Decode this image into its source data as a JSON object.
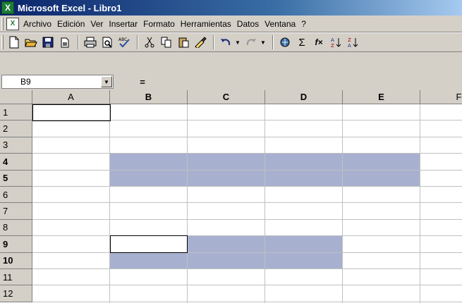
{
  "titlebar": {
    "icon": "X",
    "title": "Microsoft Excel - Libro1"
  },
  "menubar": {
    "items": [
      "Archivo",
      "Edición",
      "Ver",
      "Insertar",
      "Formato",
      "Herramientas",
      "Datos",
      "Ventana",
      "?"
    ]
  },
  "toolbar": {
    "buttons": [
      "new-icon",
      "open-icon",
      "save-icon",
      "permission-icon",
      "print-icon",
      "print-preview-icon",
      "spelling-icon",
      "cut-icon",
      "copy-icon",
      "paste-icon",
      "format-painter-icon",
      "undo-icon",
      "redo-icon",
      "hyperlink-icon",
      "autosum-icon",
      "function-icon",
      "sort-ascending-icon",
      "sort-descending-icon"
    ],
    "autosum_glyph": "Σ",
    "function_glyph": "f×"
  },
  "formulabar": {
    "name_box": "B9",
    "equals": "=",
    "formula": ""
  },
  "grid": {
    "columns": [
      "A",
      "B",
      "C",
      "D",
      "E",
      "F"
    ],
    "rows": [
      "1",
      "2",
      "3",
      "4",
      "5",
      "6",
      "7",
      "8",
      "9",
      "10",
      "11",
      "12"
    ],
    "bold_columns": [
      "B",
      "C",
      "D",
      "E"
    ],
    "bold_rows": [
      "4",
      "5",
      "9",
      "10"
    ]
  },
  "colors": {
    "selection": "#a7b1cf",
    "title_start": "#0a246a",
    "title_end": "#a6caf0"
  }
}
